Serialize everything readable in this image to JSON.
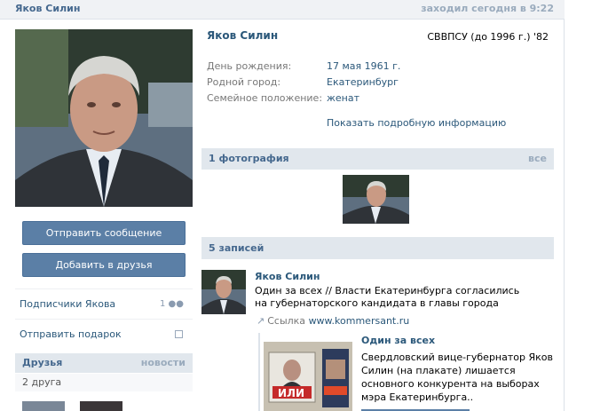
{
  "header": {
    "name": "Яков Силин",
    "online_status": "заходил сегодня в 9:22"
  },
  "left": {
    "send_message_label": "Отправить сообщение",
    "add_friend_label": "Добавить в друзья",
    "followers_label": "Подписчики Якова",
    "followers_count": "1",
    "send_gift_label": "Отправить подарок",
    "friends": {
      "title": "Друзья",
      "news_link": "новости",
      "count_label": "2 друга"
    }
  },
  "profile": {
    "name": "Яков Силин",
    "school": "СВВПСУ (до 1996 г.) '82",
    "info": [
      {
        "label": "День рождения:",
        "value": "17 мая 1961 г."
      },
      {
        "label": "Родной город:",
        "value": "Екатеринбург"
      },
      {
        "label": "Семейное положение:",
        "value": "женат"
      }
    ],
    "more_info_link": "Показать подробную информацию"
  },
  "photos": {
    "title": "1 фотография",
    "all_link": "все"
  },
  "wall": {
    "title": "5 записей",
    "post": {
      "author": "Яков Силин",
      "text": "Один за всех // Власти Екатеринбурга согласились на губернаторского кандидата в главы города",
      "link_prefix": "Ссылка",
      "link_domain": "www.kommersant.ru",
      "attachment_title": "Один за всех",
      "attachment_text": "Свердловский вице-губернатор Яков Силин (на плакате) лишается основного конкурента на выборах мэра Екатеринбурга..",
      "poster_text": "ИЛИ"
    }
  },
  "colors": {
    "link": "#2b587a",
    "header_bg": "#e1e7ed",
    "button": "#5b7fa6"
  }
}
